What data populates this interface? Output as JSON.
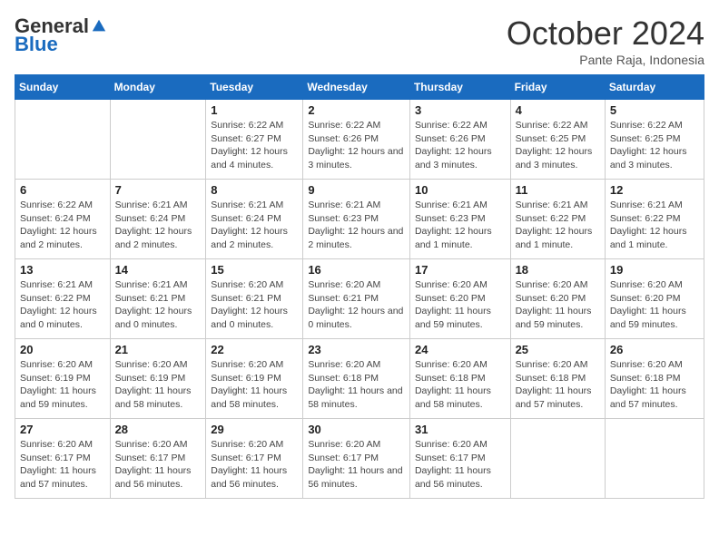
{
  "header": {
    "logo_general": "General",
    "logo_blue": "Blue",
    "month": "October 2024",
    "location": "Pante Raja, Indonesia"
  },
  "days_of_week": [
    "Sunday",
    "Monday",
    "Tuesday",
    "Wednesday",
    "Thursday",
    "Friday",
    "Saturday"
  ],
  "weeks": [
    [
      {
        "day": null
      },
      {
        "day": null
      },
      {
        "day": 1,
        "sunrise": "6:22 AM",
        "sunset": "6:27 PM",
        "daylight": "12 hours and 4 minutes."
      },
      {
        "day": 2,
        "sunrise": "6:22 AM",
        "sunset": "6:26 PM",
        "daylight": "12 hours and 3 minutes."
      },
      {
        "day": 3,
        "sunrise": "6:22 AM",
        "sunset": "6:26 PM",
        "daylight": "12 hours and 3 minutes."
      },
      {
        "day": 4,
        "sunrise": "6:22 AM",
        "sunset": "6:25 PM",
        "daylight": "12 hours and 3 minutes."
      },
      {
        "day": 5,
        "sunrise": "6:22 AM",
        "sunset": "6:25 PM",
        "daylight": "12 hours and 3 minutes."
      }
    ],
    [
      {
        "day": 6,
        "sunrise": "6:22 AM",
        "sunset": "6:24 PM",
        "daylight": "12 hours and 2 minutes."
      },
      {
        "day": 7,
        "sunrise": "6:21 AM",
        "sunset": "6:24 PM",
        "daylight": "12 hours and 2 minutes."
      },
      {
        "day": 8,
        "sunrise": "6:21 AM",
        "sunset": "6:24 PM",
        "daylight": "12 hours and 2 minutes."
      },
      {
        "day": 9,
        "sunrise": "6:21 AM",
        "sunset": "6:23 PM",
        "daylight": "12 hours and 2 minutes."
      },
      {
        "day": 10,
        "sunrise": "6:21 AM",
        "sunset": "6:23 PM",
        "daylight": "12 hours and 1 minute."
      },
      {
        "day": 11,
        "sunrise": "6:21 AM",
        "sunset": "6:22 PM",
        "daylight": "12 hours and 1 minute."
      },
      {
        "day": 12,
        "sunrise": "6:21 AM",
        "sunset": "6:22 PM",
        "daylight": "12 hours and 1 minute."
      }
    ],
    [
      {
        "day": 13,
        "sunrise": "6:21 AM",
        "sunset": "6:22 PM",
        "daylight": "12 hours and 0 minutes."
      },
      {
        "day": 14,
        "sunrise": "6:21 AM",
        "sunset": "6:21 PM",
        "daylight": "12 hours and 0 minutes."
      },
      {
        "day": 15,
        "sunrise": "6:20 AM",
        "sunset": "6:21 PM",
        "daylight": "12 hours and 0 minutes."
      },
      {
        "day": 16,
        "sunrise": "6:20 AM",
        "sunset": "6:21 PM",
        "daylight": "12 hours and 0 minutes."
      },
      {
        "day": 17,
        "sunrise": "6:20 AM",
        "sunset": "6:20 PM",
        "daylight": "11 hours and 59 minutes."
      },
      {
        "day": 18,
        "sunrise": "6:20 AM",
        "sunset": "6:20 PM",
        "daylight": "11 hours and 59 minutes."
      },
      {
        "day": 19,
        "sunrise": "6:20 AM",
        "sunset": "6:20 PM",
        "daylight": "11 hours and 59 minutes."
      }
    ],
    [
      {
        "day": 20,
        "sunrise": "6:20 AM",
        "sunset": "6:19 PM",
        "daylight": "11 hours and 59 minutes."
      },
      {
        "day": 21,
        "sunrise": "6:20 AM",
        "sunset": "6:19 PM",
        "daylight": "11 hours and 58 minutes."
      },
      {
        "day": 22,
        "sunrise": "6:20 AM",
        "sunset": "6:19 PM",
        "daylight": "11 hours and 58 minutes."
      },
      {
        "day": 23,
        "sunrise": "6:20 AM",
        "sunset": "6:18 PM",
        "daylight": "11 hours and 58 minutes."
      },
      {
        "day": 24,
        "sunrise": "6:20 AM",
        "sunset": "6:18 PM",
        "daylight": "11 hours and 58 minutes."
      },
      {
        "day": 25,
        "sunrise": "6:20 AM",
        "sunset": "6:18 PM",
        "daylight": "11 hours and 57 minutes."
      },
      {
        "day": 26,
        "sunrise": "6:20 AM",
        "sunset": "6:18 PM",
        "daylight": "11 hours and 57 minutes."
      }
    ],
    [
      {
        "day": 27,
        "sunrise": "6:20 AM",
        "sunset": "6:17 PM",
        "daylight": "11 hours and 57 minutes."
      },
      {
        "day": 28,
        "sunrise": "6:20 AM",
        "sunset": "6:17 PM",
        "daylight": "11 hours and 56 minutes."
      },
      {
        "day": 29,
        "sunrise": "6:20 AM",
        "sunset": "6:17 PM",
        "daylight": "11 hours and 56 minutes."
      },
      {
        "day": 30,
        "sunrise": "6:20 AM",
        "sunset": "6:17 PM",
        "daylight": "11 hours and 56 minutes."
      },
      {
        "day": 31,
        "sunrise": "6:20 AM",
        "sunset": "6:17 PM",
        "daylight": "11 hours and 56 minutes."
      },
      {
        "day": null
      },
      {
        "day": null
      }
    ]
  ],
  "labels": {
    "sunrise": "Sunrise:",
    "sunset": "Sunset:",
    "daylight": "Daylight:"
  }
}
